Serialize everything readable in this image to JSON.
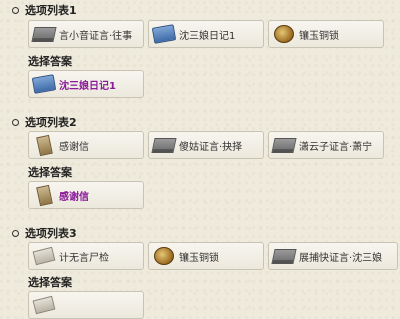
{
  "sections": [
    {
      "title": "选项列表1",
      "options": [
        {
          "label": "言小音证言·往事",
          "icon": "document-icon"
        },
        {
          "label": "沈三娘日记1",
          "icon": "diary-icon"
        },
        {
          "label": "镶玉铜锁",
          "icon": "bronze-lock-icon"
        }
      ],
      "answer_title": "选择答案",
      "answer": {
        "label": "沈三娘日记1",
        "icon": "diary-icon"
      }
    },
    {
      "title": "选项列表2",
      "options": [
        {
          "label": "感谢信",
          "icon": "letter-icon"
        },
        {
          "label": "傻姑证言·抉择",
          "icon": "document-icon"
        },
        {
          "label": "潇云子证言·萧宁",
          "icon": "document-icon"
        }
      ],
      "answer_title": "选择答案",
      "answer": {
        "label": "感谢信",
        "icon": "letter-icon"
      }
    },
    {
      "title": "选项列表3",
      "options": [
        {
          "label": "计无言尸检",
          "icon": "paper-icon"
        },
        {
          "label": "镶玉铜锁",
          "icon": "bronze-lock-icon"
        },
        {
          "label": "展捕快证言·沈三娘",
          "icon": "document-icon"
        }
      ],
      "answer_title": "选择答案"
    }
  ]
}
